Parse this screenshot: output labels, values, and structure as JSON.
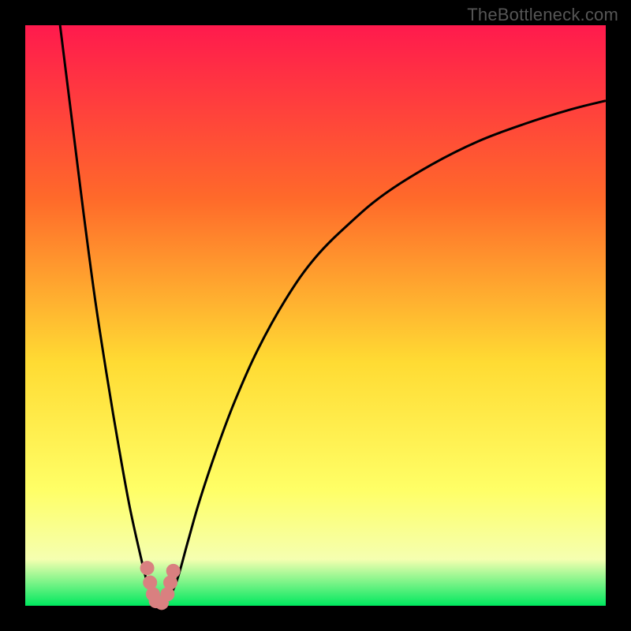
{
  "watermark": "TheBottleneck.com",
  "colors": {
    "frame": "#000000",
    "grad_top": "#ff1a4d",
    "grad_mid1": "#ff6a2a",
    "grad_mid2": "#ffdb33",
    "grad_mid3": "#ffff66",
    "grad_mid4": "#f5ffb0",
    "grad_bottom": "#00e85f",
    "curve": "#000000",
    "marker": "#d98080"
  },
  "chart_data": {
    "type": "line",
    "title": "",
    "xlabel": "",
    "ylabel": "",
    "xlim": [
      0,
      100
    ],
    "ylim": [
      0,
      100
    ],
    "series": [
      {
        "name": "left_curve",
        "x": [
          6,
          8,
          10,
          12,
          14,
          16,
          18,
          20,
          21,
          22,
          23
        ],
        "values": [
          100,
          84,
          68,
          53,
          40,
          28,
          17,
          8,
          4,
          1,
          0
        ]
      },
      {
        "name": "right_curve",
        "x": [
          24,
          26,
          28,
          30,
          33,
          36,
          40,
          45,
          50,
          56,
          62,
          70,
          78,
          86,
          94,
          100
        ],
        "values": [
          0,
          4,
          11,
          18,
          27,
          35,
          44,
          53,
          60,
          66,
          71,
          76,
          80,
          83,
          85.5,
          87
        ]
      }
    ],
    "markers": [
      {
        "x": 21.0,
        "y": 6.5
      },
      {
        "x": 21.5,
        "y": 4.0
      },
      {
        "x": 22.0,
        "y": 2.0
      },
      {
        "x": 22.5,
        "y": 0.8
      },
      {
        "x": 23.5,
        "y": 0.5
      },
      {
        "x": 24.5,
        "y": 2.0
      },
      {
        "x": 25.0,
        "y": 4.0
      },
      {
        "x": 25.5,
        "y": 6.0
      }
    ],
    "grid": false,
    "legend_position": "none"
  }
}
